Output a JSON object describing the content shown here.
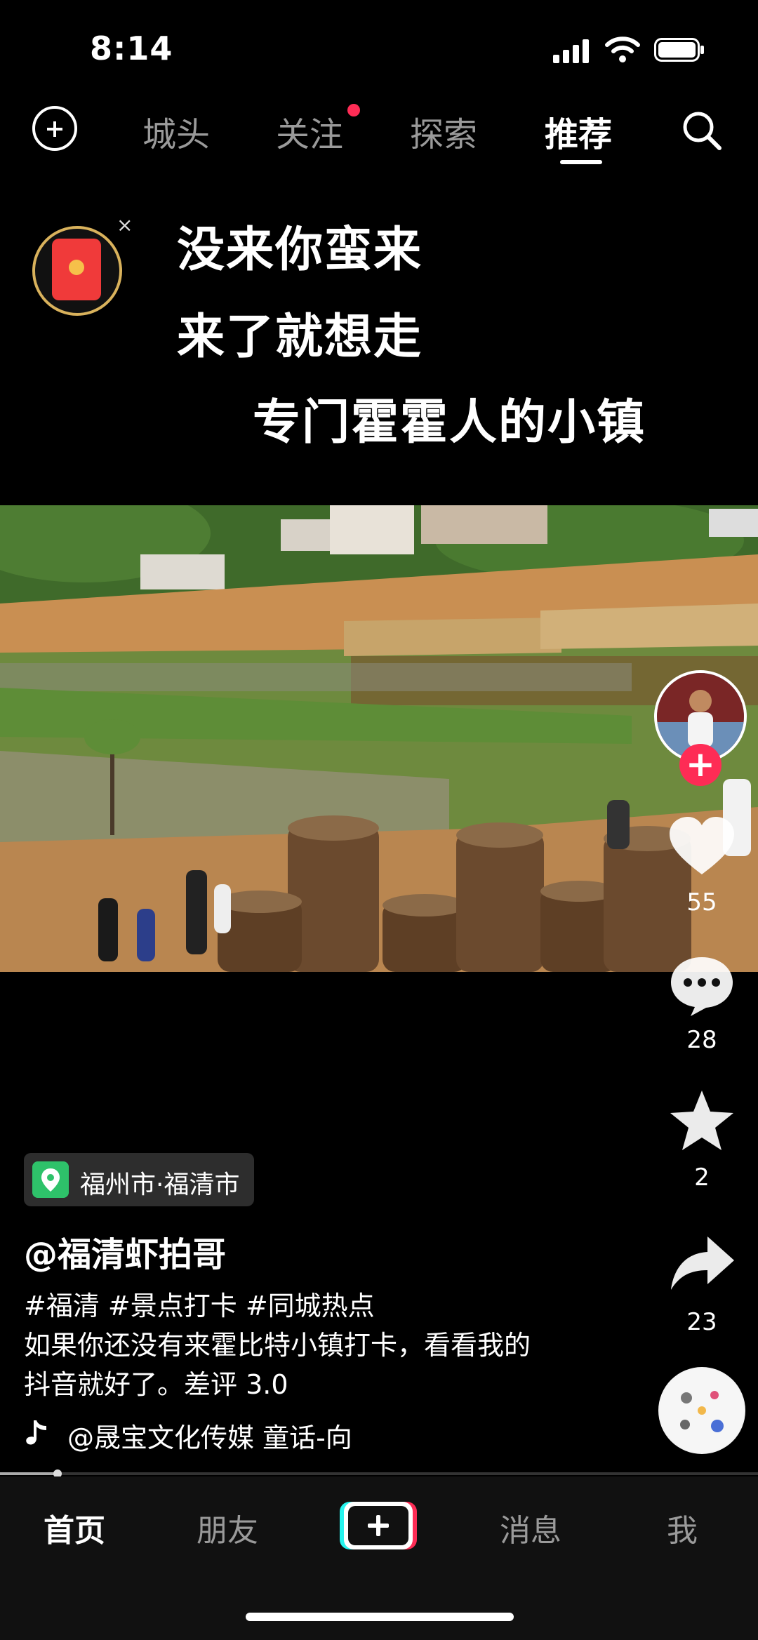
{
  "status_bar": {
    "time": "8:14"
  },
  "top_nav": {
    "tabs": [
      "城头",
      "关注",
      "探索",
      "推荐"
    ],
    "active_tab": "推荐"
  },
  "captions": {
    "line1": "没来你蛮来",
    "line2": "来了就想走",
    "line3": "专门霍霍人的小镇"
  },
  "red_packet": {
    "close": "×"
  },
  "right_rail": {
    "likes": "55",
    "comments": "28",
    "favorites": "2",
    "shares": "23",
    "follow_plus": "+"
  },
  "post": {
    "location": "福州市·福清市",
    "username": "@福清虾拍哥",
    "hashtags": "#福清 #景点打卡 #同城热点",
    "description_line1": "如果你还没有来霍比特小镇打卡，看看我的",
    "description_line2": "抖音就好了。差评 3.0",
    "music": "@晟宝文化传媒    童话-向"
  },
  "bottom_nav": {
    "home": "首页",
    "friends": "朋友",
    "messages": "消息",
    "me": "我"
  },
  "colors": {
    "accent": "#fe2c55",
    "location_green": "#2ec26a",
    "inactive": "#9a9a9a"
  },
  "icons": [
    "add-circle-icon",
    "search-icon",
    "red-packet-icon",
    "heart-icon",
    "comment-icon",
    "star-icon",
    "share-icon",
    "location-pin-icon",
    "music-note-icon",
    "plus-icon"
  ]
}
